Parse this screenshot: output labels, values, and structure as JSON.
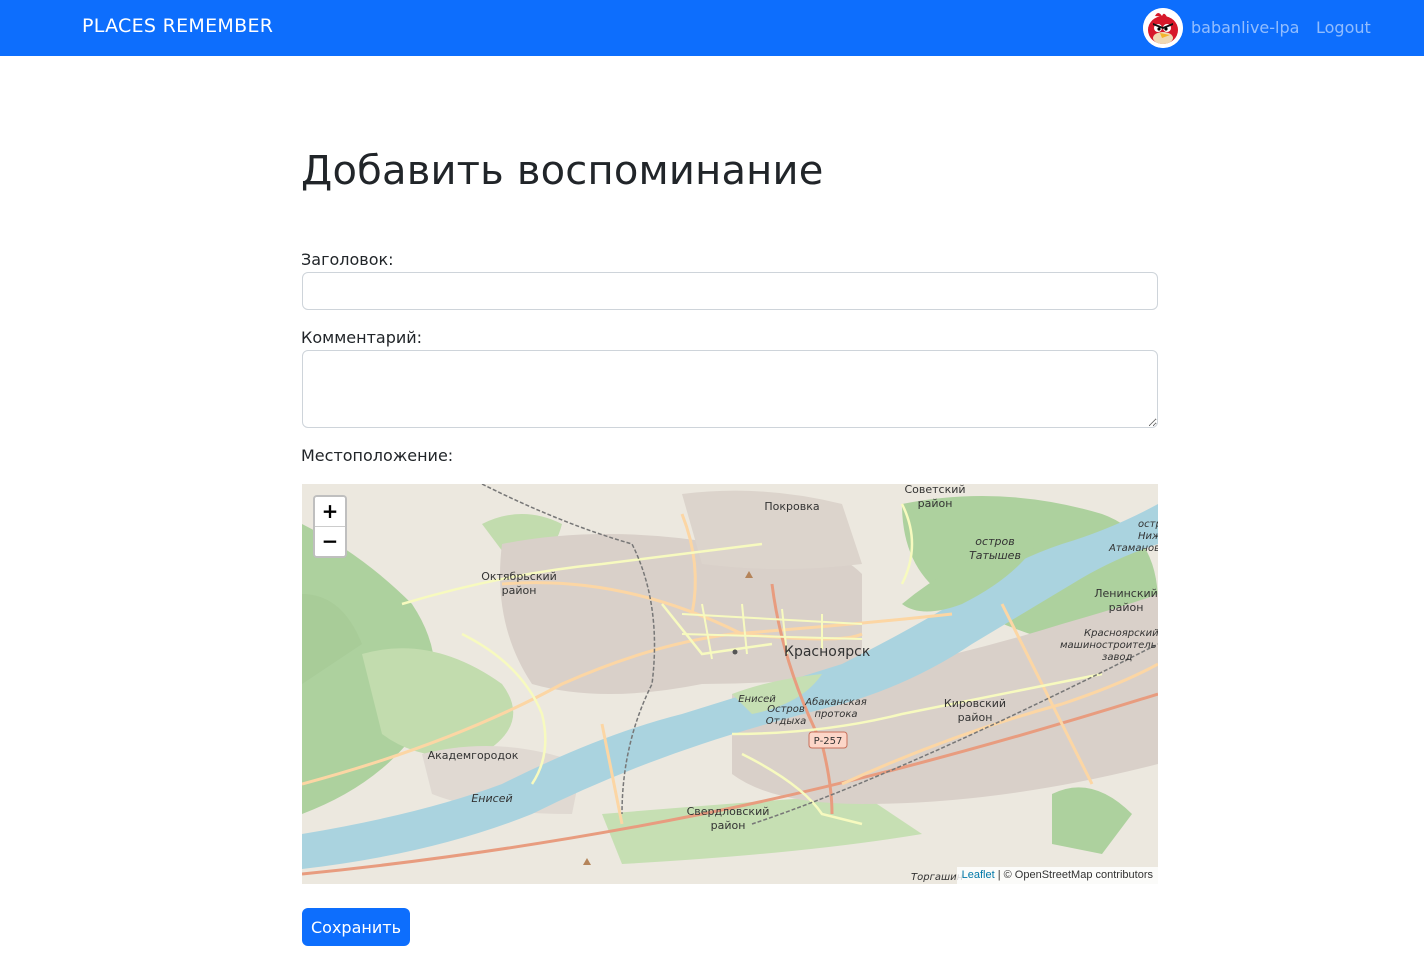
{
  "navbar": {
    "brand": "PLACES REMEMBER",
    "username": "babanlive-lpa",
    "logout_label": "Logout",
    "colors": {
      "background": "#0d6efd"
    }
  },
  "main": {
    "title": "Добавить воспоминание",
    "form": {
      "title_label": "Заголовок:",
      "title_value": "",
      "comment_label": "Комментарий:",
      "comment_value": "",
      "location_label": "Местоположение:",
      "save_label": "Сохранить"
    }
  },
  "map": {
    "zoom_in": "+",
    "zoom_out": "−",
    "attribution_link": "Leaflet",
    "attribution_text": " | © OpenStreetMap contributors",
    "labels": {
      "city": "Красноярск",
      "oktyabrsky_1": "Октябрьский",
      "oktyabrsky_2": "район",
      "pokrovka": "Покровка",
      "sovetsky_1": "Советский",
      "sovetsky_2": "район",
      "tatyshev_1": "остров",
      "tatyshev_2": "Татышев",
      "nizhny_1": "остро",
      "nizhny_2": "Нижни",
      "nizhny_3": "Атаманов",
      "leninsky_1": "Ленинский",
      "leninsky_2": "район",
      "kms_1": "Красноярский",
      "kms_2": "машиностроитель",
      "kms_3": "завод",
      "kirovsky_1": "Кировский",
      "kirovsky_2": "район",
      "otdykh_1": "Остров",
      "otdykh_2": "Отдыха",
      "abakan_1": "Абаканская",
      "abakan_2": "протока",
      "enisei_1": "Енисей",
      "enisei_2": "Енисей",
      "road": "Р-257",
      "akadem": "Академгородок",
      "sverdlovsky_1": "Свердловский",
      "sverdlovsky_2": "район",
      "torgashino": "Торгашин"
    },
    "colors": {
      "water": "#aad3df",
      "forest": "#add19e",
      "urban": "#d9d0c9",
      "road": "#f7fabf",
      "major_road": "#fcd6a4"
    }
  }
}
